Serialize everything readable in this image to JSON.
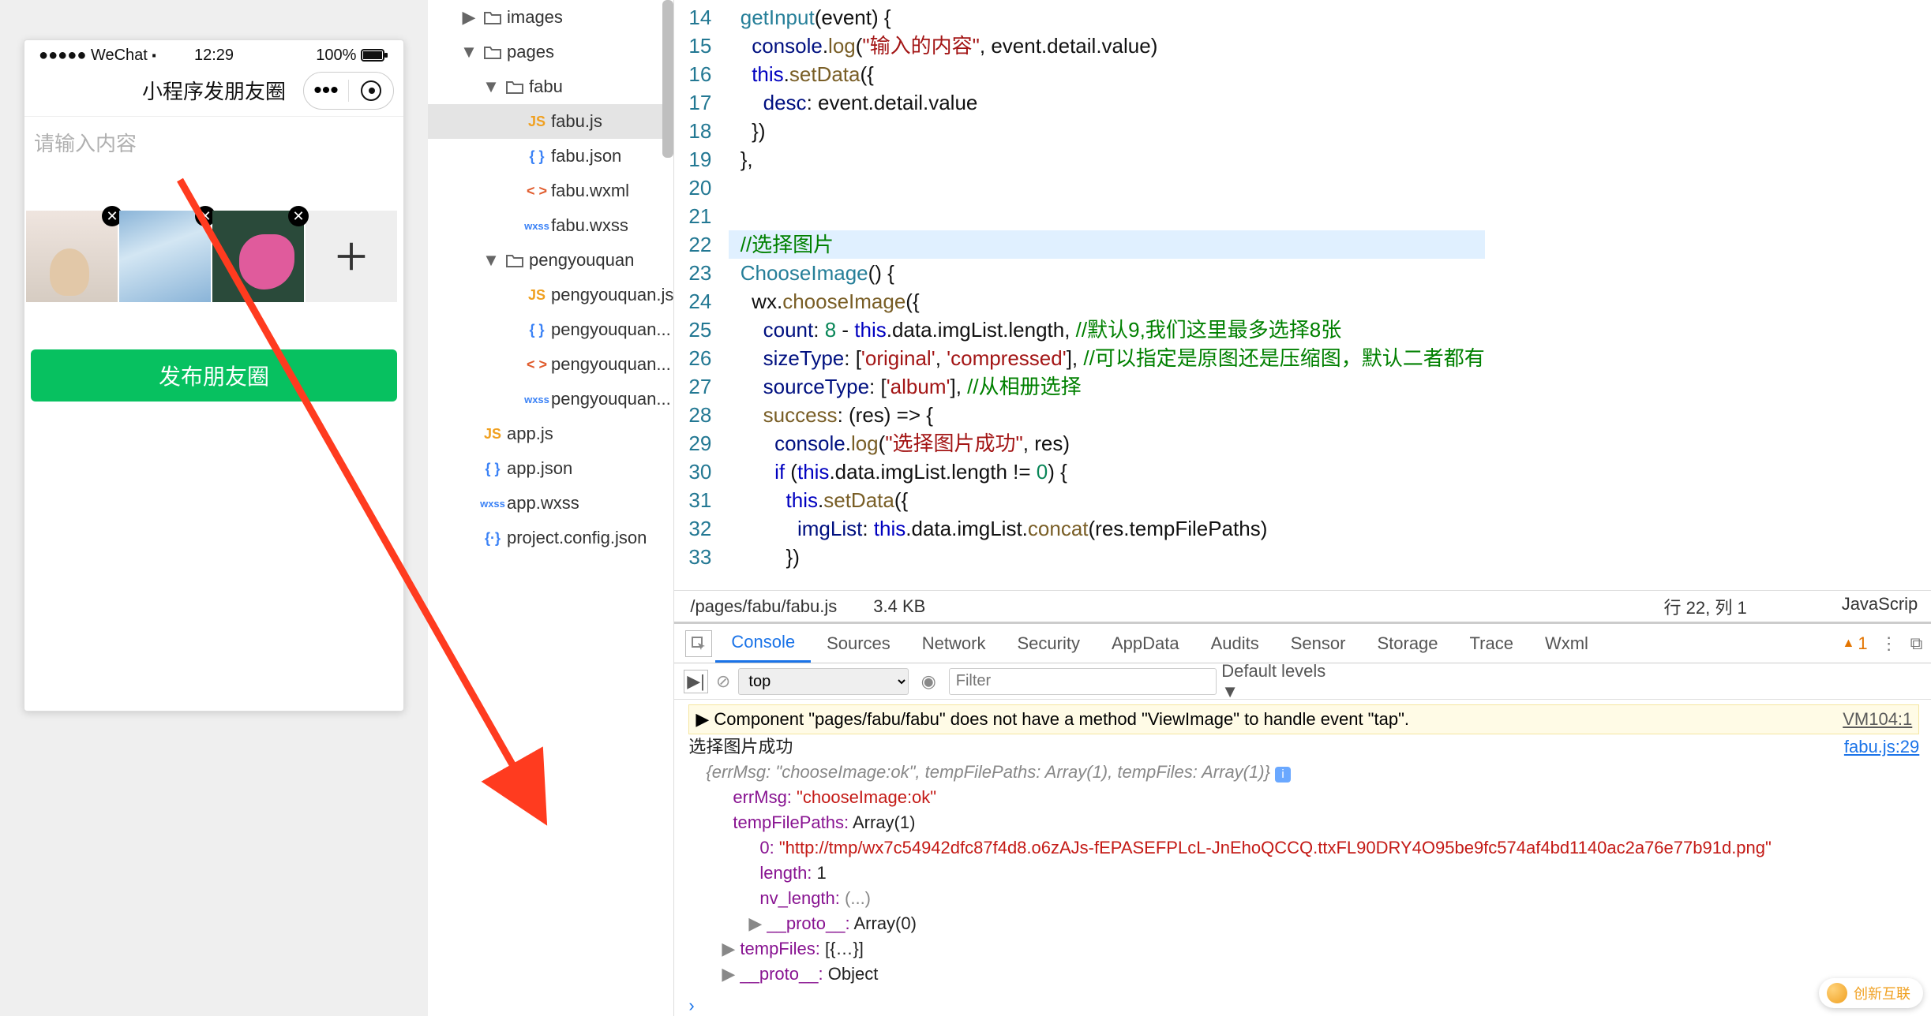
{
  "simulator": {
    "status_left": "●●●●● WeChat ⬝",
    "status_time": "12:29",
    "status_batt": "100%",
    "nav_title": "小程序发朋友圈",
    "textarea_placeholder": "请输入内容",
    "publish_label": "发布朋友圈"
  },
  "filetree": [
    {
      "indent": 1,
      "arrow": "▶",
      "icon": "folder",
      "label": "images"
    },
    {
      "indent": 1,
      "arrow": "▼",
      "icon": "folder",
      "label": "pages"
    },
    {
      "indent": 2,
      "arrow": "▼",
      "icon": "folder",
      "label": "fabu"
    },
    {
      "indent": 3,
      "arrow": "",
      "icon": "js",
      "label": "fabu.js",
      "sel": true
    },
    {
      "indent": 3,
      "arrow": "",
      "icon": "json",
      "label": "fabu.json"
    },
    {
      "indent": 3,
      "arrow": "",
      "icon": "wxml",
      "label": "fabu.wxml"
    },
    {
      "indent": 3,
      "arrow": "",
      "icon": "wxss",
      "label": "fabu.wxss"
    },
    {
      "indent": 2,
      "arrow": "▼",
      "icon": "folder",
      "label": "pengyouquan"
    },
    {
      "indent": 3,
      "arrow": "",
      "icon": "js",
      "label": "pengyouquan.js"
    },
    {
      "indent": 3,
      "arrow": "",
      "icon": "json",
      "label": "pengyouquan..."
    },
    {
      "indent": 3,
      "arrow": "",
      "icon": "wxml",
      "label": "pengyouquan..."
    },
    {
      "indent": 3,
      "arrow": "",
      "icon": "wxss",
      "label": "pengyouquan..."
    },
    {
      "indent": 1,
      "arrow": "",
      "icon": "js",
      "label": "app.js"
    },
    {
      "indent": 1,
      "arrow": "",
      "icon": "json",
      "label": "app.json"
    },
    {
      "indent": 1,
      "arrow": "",
      "icon": "wxss",
      "label": "app.wxss"
    },
    {
      "indent": 1,
      "arrow": "",
      "icon": "json",
      "label": "project.config.json",
      "iconText": "{·}",
      "iconColor": "#098658"
    }
  ],
  "editor": {
    "path": "/pages/fabu/fabu.js",
    "size": "3.4 KB",
    "cursor": "行 22,  列 1",
    "lang": "JavaScrip",
    "first_line_no": 14,
    "lines": [
      [
        [
          "fn",
          "getInput"
        ],
        [
          "op",
          "(event) {"
        ]
      ],
      [
        [
          "op",
          "  "
        ],
        [
          "prop",
          "console"
        ],
        [
          "op",
          "."
        ],
        [
          "call",
          "log"
        ],
        [
          "op",
          "("
        ],
        [
          "str",
          "\"输入的内容\""
        ],
        [
          "op",
          ", event.detail.value)"
        ]
      ],
      [
        [
          "op",
          "  "
        ],
        [
          "this",
          "this"
        ],
        [
          "op",
          "."
        ],
        [
          "call",
          "setData"
        ],
        [
          "op",
          "({"
        ]
      ],
      [
        [
          "op",
          "    "
        ],
        [
          "prop",
          "desc"
        ],
        [
          "op",
          ": event.detail.value"
        ]
      ],
      [
        [
          "op",
          "  })"
        ]
      ],
      [
        [
          "op",
          "},"
        ]
      ],
      [
        [
          "op",
          ""
        ]
      ],
      [
        [
          "op",
          ""
        ]
      ],
      [
        [
          "cmt",
          "//选择图片"
        ]
      ],
      [
        [
          "fn",
          "ChooseImage"
        ],
        [
          "op",
          "() {"
        ]
      ],
      [
        [
          "op",
          "  wx."
        ],
        [
          "call",
          "chooseImage"
        ],
        [
          "op",
          "({"
        ]
      ],
      [
        [
          "op",
          "    "
        ],
        [
          "prop",
          "count"
        ],
        [
          "op",
          ": "
        ],
        [
          "num",
          "8"
        ],
        [
          "op",
          " - "
        ],
        [
          "this",
          "this"
        ],
        [
          "op",
          ".data.imgList.length, "
        ],
        [
          "cmt",
          "//默认9,我们这里最多选择8张"
        ]
      ],
      [
        [
          "op",
          "    "
        ],
        [
          "prop",
          "sizeType"
        ],
        [
          "op",
          ": ["
        ],
        [
          "str",
          "'original'"
        ],
        [
          "op",
          ", "
        ],
        [
          "str",
          "'compressed'"
        ],
        [
          "op",
          "], "
        ],
        [
          "cmt",
          "//可以指定是原图还是压缩图，默认二者都有"
        ]
      ],
      [
        [
          "op",
          "    "
        ],
        [
          "prop",
          "sourceType"
        ],
        [
          "op",
          ": ["
        ],
        [
          "str",
          "'album'"
        ],
        [
          "op",
          "], "
        ],
        [
          "cmt",
          "//从相册选择"
        ]
      ],
      [
        [
          "op",
          "    "
        ],
        [
          "call",
          "success"
        ],
        [
          "op",
          ": (res) => {"
        ]
      ],
      [
        [
          "op",
          "      "
        ],
        [
          "prop",
          "console"
        ],
        [
          "op",
          "."
        ],
        [
          "call",
          "log"
        ],
        [
          "op",
          "("
        ],
        [
          "str",
          "\"选择图片成功\""
        ],
        [
          "op",
          ", res)"
        ]
      ],
      [
        [
          "op",
          "      "
        ],
        [
          "kw",
          "if"
        ],
        [
          "op",
          " ("
        ],
        [
          "this",
          "this"
        ],
        [
          "op",
          ".data.imgList.length != "
        ],
        [
          "num",
          "0"
        ],
        [
          "op",
          ") {"
        ]
      ],
      [
        [
          "op",
          "        "
        ],
        [
          "this",
          "this"
        ],
        [
          "op",
          "."
        ],
        [
          "call",
          "setData"
        ],
        [
          "op",
          "({"
        ]
      ],
      [
        [
          "op",
          "          "
        ],
        [
          "prop",
          "imgList"
        ],
        [
          "op",
          ": "
        ],
        [
          "this",
          "this"
        ],
        [
          "op",
          ".data.imgList."
        ],
        [
          "call",
          "concat"
        ],
        [
          "op",
          "(res.tempFilePaths)"
        ]
      ],
      [
        [
          "op",
          "        })"
        ]
      ]
    ],
    "highlight_index": 8
  },
  "devtools": {
    "tabs": [
      "Console",
      "Sources",
      "Network",
      "Security",
      "AppData",
      "Audits",
      "Sensor",
      "Storage",
      "Trace",
      "Wxml"
    ],
    "active_tab": "Console",
    "warn_count": "1",
    "context": "top",
    "filter_placeholder": "Filter",
    "levels": "Default levels ▼",
    "warning_line": "Component \"pages/fabu/fabu\" does not have a method \"ViewImage\" to handle event \"tap\".",
    "warning_src": "VM104:1",
    "log_line": "选择图片成功",
    "log_src": "fabu.js:29",
    "obj_summary": "{errMsg: \"chooseImage:ok\", tempFilePaths: Array(1), tempFiles: Array(1)}",
    "props": {
      "errMsg_key": "errMsg:",
      "errMsg_val": "\"chooseImage:ok\"",
      "tfp_key": "tempFilePaths:",
      "tfp_val": "Array(1)",
      "idx_key": "0:",
      "idx_val": "\"http://tmp/wx7c54942dfc87f4d8.o6zAJs-fEPASEFPLcL-JnEhoQCCQ.ttxFL90DRY4O95be9fc574af4bd1140ac2a76e77b91d.png\"",
      "len_key": "length:",
      "len_val": "1",
      "nv_key": "nv_length:",
      "nv_val": "(...)",
      "proto1_key": "__proto__:",
      "proto1_val": "Array(0)",
      "tf_key": "tempFiles:",
      "tf_val": "[{…}]",
      "proto2_key": "__proto__:",
      "proto2_val": "Object"
    }
  },
  "watermark": "创新互联"
}
